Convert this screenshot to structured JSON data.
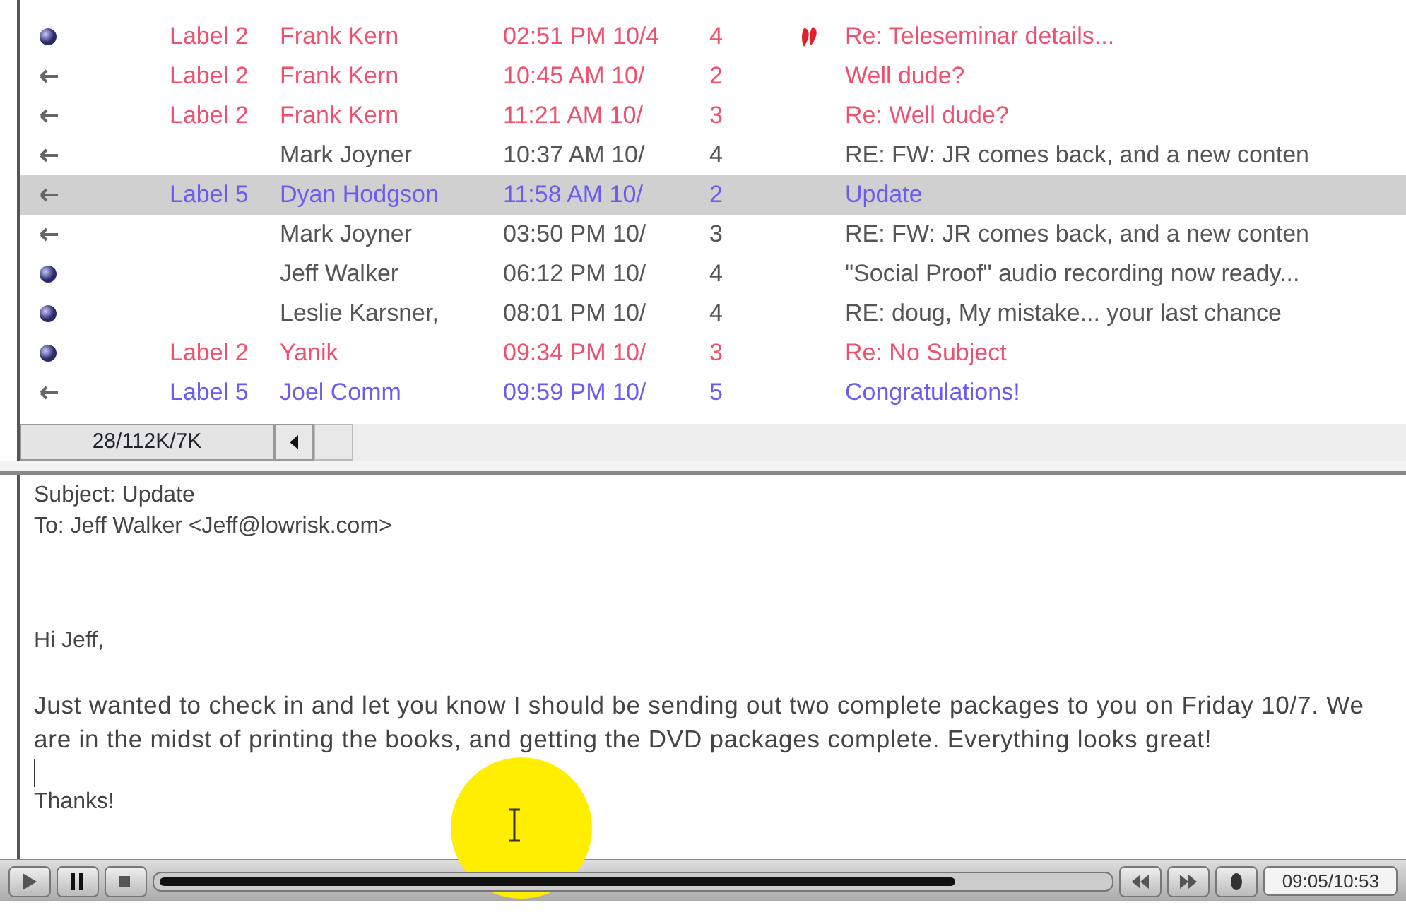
{
  "message_list": {
    "rows": [
      {
        "kind": "dot",
        "label": "Label 2",
        "from": "Frank Kern",
        "time": "02:51 PM 10/4",
        "count": "4",
        "flagged": true,
        "subject": "Re: Teleseminar details...",
        "color": "#f0506e",
        "selected": false
      },
      {
        "kind": "arrow",
        "label": "Label 2",
        "from": "Frank Kern",
        "time": "10:45 AM 10/",
        "count": "2",
        "flagged": false,
        "subject": "Well dude?",
        "color": "#f0506e",
        "selected": false
      },
      {
        "kind": "arrow",
        "label": "Label 2",
        "from": "Frank Kern",
        "time": "11:21 AM 10/",
        "count": "3",
        "flagged": false,
        "subject": "Re: Well dude?",
        "color": "#f0506e",
        "selected": false
      },
      {
        "kind": "arrow",
        "from": "Mark Joyner",
        "time": "10:37 AM 10/",
        "count": "4",
        "flagged": false,
        "subject": "RE: FW: JR comes back, and a new conten",
        "color": "#555555",
        "selected": false
      },
      {
        "kind": "arrow",
        "label": "Label 5",
        "from": "Dyan Hodgson",
        "time": "11:58 AM 10/",
        "count": "2",
        "flagged": false,
        "subject": "Update",
        "color": "#6a5cf0",
        "selected": true
      },
      {
        "kind": "arrow",
        "from": "Mark Joyner",
        "time": "03:50 PM 10/",
        "count": "3",
        "flagged": false,
        "subject": "RE: FW: JR comes back, and a new conten",
        "color": "#555555",
        "selected": false
      },
      {
        "kind": "dot",
        "from": "Jeff Walker",
        "time": "06:12 PM 10/",
        "count": "4",
        "flagged": false,
        "subject": "\"Social Proof\" audio recording now ready...",
        "color": "#555555",
        "selected": false
      },
      {
        "kind": "dot",
        "from": "Leslie Karsner,",
        "time": "08:01 PM 10/",
        "count": "4",
        "flagged": false,
        "subject": "RE: doug, My mistake... your last chance",
        "color": "#555555",
        "selected": false
      },
      {
        "kind": "dot",
        "label": "Label 2",
        "from": "Yanik",
        "time": "09:34 PM 10/",
        "count": "3",
        "flagged": false,
        "subject": "Re: No Subject",
        "color": "#f0506e",
        "selected": false
      },
      {
        "kind": "arrow",
        "label": "Label 5",
        "from": "Joel Comm",
        "time": "09:59 PM 10/",
        "count": "5",
        "flagged": false,
        "subject": "Congratulations!",
        "color": "#6a5cf0",
        "selected": false
      }
    ]
  },
  "status_bar": {
    "info": "28/112K/7K"
  },
  "message": {
    "subject_line": "Subject: Update",
    "to_line": "To: Jeff Walker <Jeff@lowrisk.com>",
    "greeting": "Hi Jeff,",
    "body": "Just wanted to check in and let you know I should be sending out two complete packages to you on Friday 10/7.  We are in the midst of printing the books, and getting the DVD packages complete.  Everything looks great!",
    "closing": "Thanks!"
  },
  "player": {
    "controls": [
      {
        "kind": "play"
      },
      {
        "kind": "pause"
      },
      {
        "kind": "stop"
      }
    ],
    "seek": {
      "level": 0.84
    },
    "skip": [
      {
        "kind": "rewind"
      },
      {
        "kind": "forward"
      },
      {
        "kind": "volume"
      }
    ],
    "time": "09:05/10:53"
  }
}
